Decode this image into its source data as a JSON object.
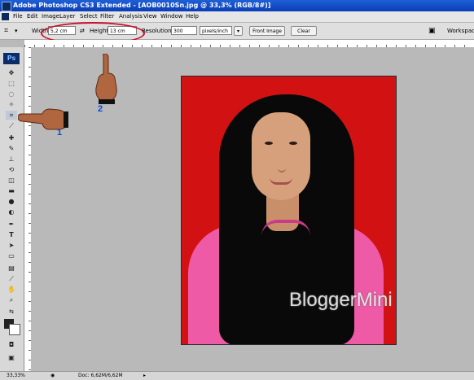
{
  "window": {
    "title": "Adobe Photoshop CS3 Extended - [AOB0010Sn.jpg @ 33,3% (RGB/8#)]"
  },
  "menubar": {
    "items": [
      "File",
      "Edit",
      "Image",
      "Layer",
      "Select",
      "Filter",
      "Analysis",
      "View",
      "Window",
      "Help"
    ]
  },
  "options": {
    "width_label": "Width:",
    "width_value": "5,2 cm",
    "height_label": "Height:",
    "height_value": "13 cm",
    "resolution_label": "Resolution:",
    "resolution_value": "300",
    "resolution_unit": "pixels/inch",
    "front_image_label": "Front Image",
    "clear_label": "Clear",
    "workspace_label": "Workspace"
  },
  "toolbox": {
    "logo": "Ps"
  },
  "annotations": {
    "hand1_number": "1",
    "hand2_number": "2"
  },
  "image": {
    "watermark": "BloggerMini"
  },
  "status": {
    "zoom": "33,33%",
    "doc": "Doc: 6,62M/6,62M"
  },
  "colors": {
    "accent": "#1f5fd6",
    "highlight_ring": "#c8102e",
    "photo_bg": "#d21212"
  }
}
